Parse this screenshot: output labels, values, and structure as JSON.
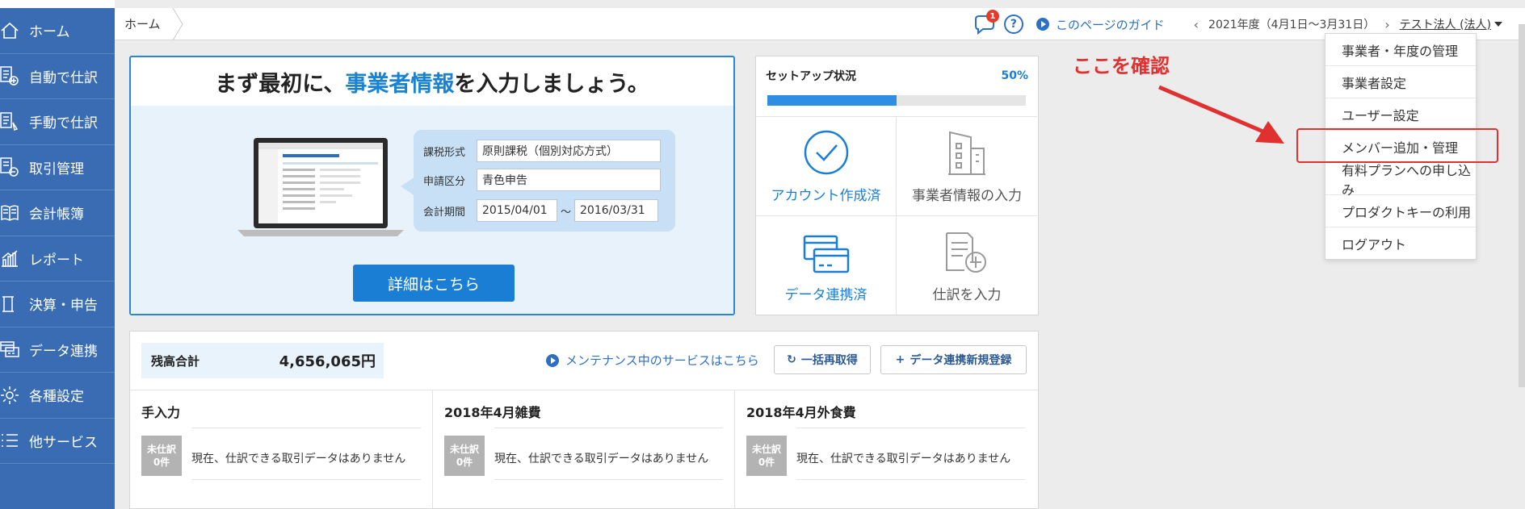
{
  "sidebar": {
    "items": [
      {
        "label": "ホーム",
        "icon": "home-icon"
      },
      {
        "label": "自動で仕訳",
        "icon": "auto-journal-icon"
      },
      {
        "label": "手動で仕訳",
        "icon": "manual-journal-icon"
      },
      {
        "label": "取引管理",
        "icon": "transactions-icon"
      },
      {
        "label": "会計帳簿",
        "icon": "ledger-icon"
      },
      {
        "label": "レポート",
        "icon": "report-icon"
      },
      {
        "label": "決算・申告",
        "icon": "settlement-icon"
      },
      {
        "label": "データ連携",
        "icon": "data-link-icon"
      },
      {
        "label": "各種設定",
        "icon": "gear-icon"
      },
      {
        "label": "他サービス",
        "icon": "list-icon"
      }
    ]
  },
  "topbar": {
    "breadcrumb": "ホーム",
    "notification_count": "1",
    "help": "?",
    "guide": "このページのガイド",
    "fiscal_year": "2021年度（4月1日〜3月31日）",
    "company": "テスト法人 (法人)"
  },
  "intro": {
    "title_pre": "まず最初に、",
    "title_hl": "事業者情報",
    "title_post": "を入力しましょう。",
    "tax_label": "課税形式",
    "tax_value": "原則課税（個別対応方式）",
    "filing_label": "申請区分",
    "filing_value": "青色申告",
    "period_label": "会計期間",
    "period_start": "2015/04/01",
    "period_sep": "〜",
    "period_end": "2016/03/31",
    "detail_button": "詳細はこちら"
  },
  "setup": {
    "title": "セットアップ状況",
    "percent_label": "50%",
    "progress": 0.5,
    "cells": [
      {
        "label": "アカウント作成済",
        "done": true
      },
      {
        "label": "事業者情報の入力",
        "done": false
      },
      {
        "label": "データ連携済",
        "done": true
      },
      {
        "label": "仕訳を入力",
        "done": false
      }
    ]
  },
  "balance": {
    "label": "残高合計",
    "value": "4,656,065円",
    "maintenance_link": "メンテナンス中のサービスはこちら",
    "refresh_button": "一括再取得",
    "add_button": "データ連携新規登録",
    "columns": [
      {
        "title": "手入力",
        "pending_line1": "未仕訳",
        "pending_line2": "0件",
        "message": "現在、仕訳できる取引データはありません"
      },
      {
        "title": "2018年4月雑費",
        "pending_line1": "未仕訳",
        "pending_line2": "0件",
        "message": "現在、仕訳できる取引データはありません"
      },
      {
        "title": "2018年4月外食費",
        "pending_line1": "未仕訳",
        "pending_line2": "0件",
        "message": "現在、仕訳できる取引データはありません"
      }
    ]
  },
  "annotation": {
    "text": "ここを確認"
  },
  "dropdown": {
    "items": [
      "事業者・年度の管理",
      "事業者設定",
      "ユーザー設定",
      "メンバー追加・管理",
      "有料プランへの申し込み",
      "プロダクトキーの利用",
      "ログアウト"
    ]
  },
  "colors": {
    "sidebar": "#3a6cb4",
    "accent": "#1a7fd4",
    "annotation": "#e03030"
  }
}
